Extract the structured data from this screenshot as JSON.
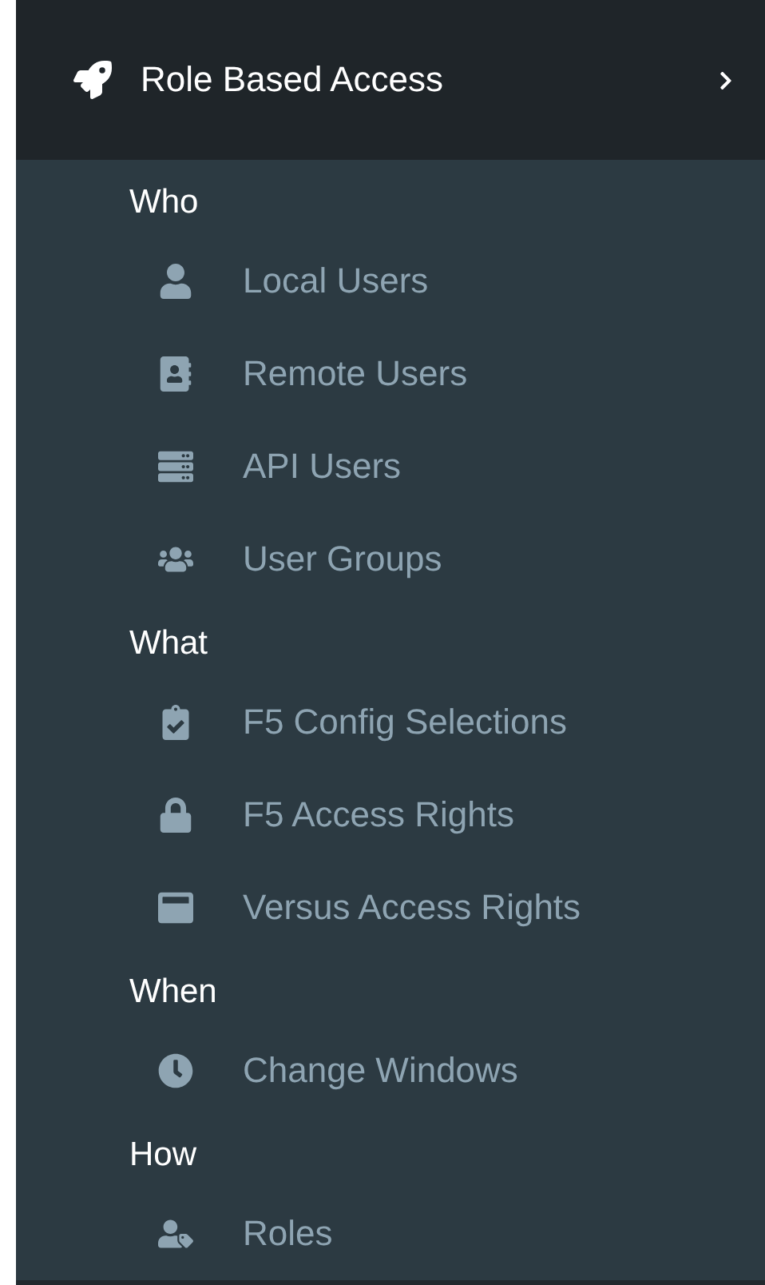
{
  "menu_header": {
    "title": "Role Based Access"
  },
  "sections": [
    {
      "heading": "Who",
      "items": [
        {
          "label": "Local Users"
        },
        {
          "label": "Remote Users"
        },
        {
          "label": "API Users"
        },
        {
          "label": "User Groups"
        }
      ]
    },
    {
      "heading": "What",
      "items": [
        {
          "label": "F5 Config Selections"
        },
        {
          "label": "F5 Access Rights"
        },
        {
          "label": "Versus Access Rights"
        }
      ]
    },
    {
      "heading": "When",
      "items": [
        {
          "label": "Change Windows"
        }
      ]
    },
    {
      "heading": "How",
      "items": [
        {
          "label": "Roles"
        }
      ]
    }
  ]
}
